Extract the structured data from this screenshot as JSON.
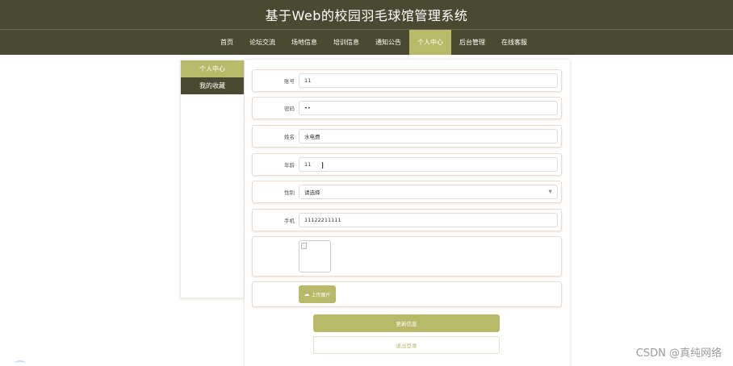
{
  "header": {
    "title": "基于Web的校园羽毛球馆管理系统"
  },
  "nav": {
    "items": [
      {
        "label": "首页",
        "active": false
      },
      {
        "label": "论坛交流",
        "active": false
      },
      {
        "label": "场地信息",
        "active": false
      },
      {
        "label": "培训信息",
        "active": false
      },
      {
        "label": "通知公告",
        "active": false
      },
      {
        "label": "个人中心",
        "active": true
      },
      {
        "label": "后台管理",
        "active": false
      },
      {
        "label": "在线客服",
        "active": false
      }
    ]
  },
  "sidebar": {
    "items": [
      {
        "label": "个人中心",
        "active": true
      },
      {
        "label": "我的收藏",
        "active": false
      }
    ]
  },
  "form": {
    "account": {
      "label": "账号",
      "value": "11"
    },
    "password": {
      "label": "密码",
      "value": "••"
    },
    "name": {
      "label": "姓名",
      "value": "水电费"
    },
    "age": {
      "label": "年龄",
      "value": "11"
    },
    "gender": {
      "label": "性别",
      "value": "请选择"
    },
    "phone": {
      "label": "手机",
      "value": "11122211111"
    },
    "upload_label": "上传图片"
  },
  "actions": {
    "update": "更新信息",
    "logout": "退出登录"
  },
  "watermark": "CSDN @真纯网络",
  "colors": {
    "header_bg": "#4a4a32",
    "accent": "#b8ba6a"
  }
}
